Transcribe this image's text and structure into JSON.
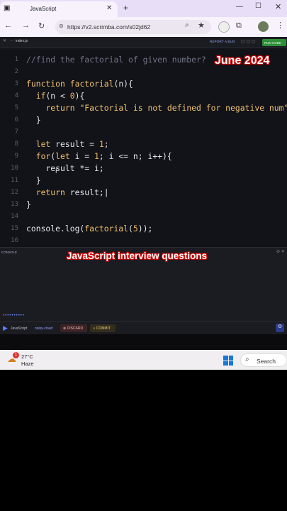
{
  "browser": {
    "tab_title": "JavaScript",
    "tab_close": "✕",
    "new_tab": "+",
    "url": "https://v2.scrimba.com/s02jd62",
    "window_min": "—",
    "window_max": "☐",
    "window_close": "✕"
  },
  "editor": {
    "file_name": "index.js",
    "report_label": "REPORT A BUG",
    "run_label": "RUN CODE",
    "lines": [
      {
        "n": "1",
        "html": "<span class='cm'>//find the factorial of given number?</span>"
      },
      {
        "n": "2",
        "html": ""
      },
      {
        "n": "3",
        "html": "<span class='kw'>function</span> <span class='fn'>factorial</span><span class='plain'>(n){</span>"
      },
      {
        "n": "4",
        "html": "  <span class='kw'>if</span><span class='plain'>(n &lt; </span><span class='num'>0</span><span class='plain'>){</span>"
      },
      {
        "n": "5",
        "html": "    <span class='kw'>return</span> <span class='str'>\"Factorial is not defined for negative num\"</span><span class='plain'>;</span>"
      },
      {
        "n": "6",
        "html": "  <span class='plain'>}</span>"
      },
      {
        "n": "7",
        "html": ""
      },
      {
        "n": "8",
        "html": "  <span class='kw'>let</span> <span class='plain'>result = </span><span class='num'>1</span><span class='plain'>;</span>"
      },
      {
        "n": "9",
        "html": "  <span class='kw'>for</span><span class='plain'>(</span><span class='kw'>let</span><span class='plain'> i = </span><span class='num'>1</span><span class='plain'>; i &lt;= n; i++){</span>"
      },
      {
        "n": "10",
        "html": "    <span class='plain'>result *= i;</span>"
      },
      {
        "n": "11",
        "html": "  <span class='plain'>}</span>"
      },
      {
        "n": "12",
        "html": "  <span class='kw'>return</span><span class='plain'> result;|</span>"
      },
      {
        "n": "13",
        "html": "<span class='plain'>}</span>"
      },
      {
        "n": "14",
        "html": ""
      },
      {
        "n": "15",
        "html": "<span class='plain'>console.log(</span><span class='fn'>factorial</span><span class='plain'>(</span><span class='num'>5</span><span class='plain'>));</span>"
      },
      {
        "n": "16",
        "html": ""
      }
    ]
  },
  "overlay": {
    "date": "June 2024",
    "title": "JavaScript interview questions"
  },
  "console": {
    "label": "CONSOLE",
    "dots": "••••••••••"
  },
  "statusbar": {
    "language": "JavaScript",
    "project": "noisy-cloud",
    "discard": "DISCARD",
    "commit": "COMMIT"
  },
  "taskbar": {
    "weather_badge": "1",
    "temperature": "27°C",
    "condition": "Haze",
    "search_label": "Search"
  },
  "colors": {
    "editor_bg": "#121318",
    "keyword": "#f0c070",
    "run_button": "#2f8f3a",
    "overlay_outline": "#cc0000"
  }
}
